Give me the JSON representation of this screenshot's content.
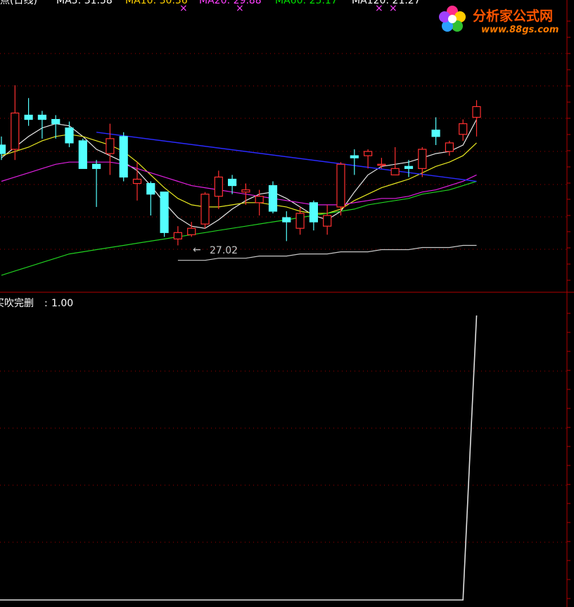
{
  "legend": {
    "title": "要点(日线)",
    "items": [
      {
        "label": "MA5: 31.58",
        "color": "#ffffff"
      },
      {
        "label": "MA10: 30.36",
        "color": "#ffd000"
      },
      {
        "label": "MA20: 29.88",
        "color": "#ff00ff"
      },
      {
        "label": "MA60: 25.17",
        "color": "#00dd00"
      },
      {
        "label": "MA120: 21.27",
        "color": "#ffffff"
      }
    ]
  },
  "logo": {
    "name": "分析家公式网",
    "url": "www.88gs.com"
  },
  "colors": {
    "up": "#ff3030",
    "down": "#54ffff",
    "frame": "#b00000",
    "grid": "#a00000",
    "trendline": "#2222ff"
  },
  "chart_data": [
    {
      "type": "candlestick",
      "title": "要点(日线)",
      "ylim": [
        25,
        37.6
      ],
      "min_marker": "27.02",
      "candles": [
        {
          "o": 31.4,
          "h": 31.8,
          "l": 30.7,
          "c": 31.0
        },
        {
          "o": 31.2,
          "h": 34.2,
          "l": 30.7,
          "c": 32.9
        },
        {
          "o": 32.8,
          "h": 33.6,
          "l": 32.3,
          "c": 32.6
        },
        {
          "o": 32.8,
          "h": 33.0,
          "l": 31.7,
          "c": 32.6
        },
        {
          "o": 32.6,
          "h": 32.8,
          "l": 31.7,
          "c": 32.4
        },
        {
          "o": 32.2,
          "h": 32.5,
          "l": 31.3,
          "c": 31.5
        },
        {
          "o": 31.6,
          "h": 31.7,
          "l": 30.5,
          "c": 30.3
        },
        {
          "o": 30.5,
          "h": 30.7,
          "l": 28.5,
          "c": 30.3
        },
        {
          "o": 31.0,
          "h": 32.4,
          "l": 30.0,
          "c": 31.7
        },
        {
          "o": 31.8,
          "h": 32.0,
          "l": 29.7,
          "c": 29.9
        },
        {
          "o": 29.6,
          "h": 30.6,
          "l": 28.8,
          "c": 29.8
        },
        {
          "o": 29.6,
          "h": 29.7,
          "l": 28.1,
          "c": 29.1
        },
        {
          "o": 29.2,
          "h": 29.2,
          "l": 27.1,
          "c": 27.3
        },
        {
          "o": 27.0,
          "h": 27.6,
          "l": 26.7,
          "c": 27.3
        },
        {
          "o": 27.2,
          "h": 27.8,
          "l": 27.1,
          "c": 27.5
        },
        {
          "o": 27.7,
          "h": 29.2,
          "l": 27.5,
          "c": 29.1
        },
        {
          "o": 29.0,
          "h": 30.2,
          "l": 28.4,
          "c": 29.9
        },
        {
          "o": 29.8,
          "h": 30.0,
          "l": 29.1,
          "c": 29.5
        },
        {
          "o": 29.2,
          "h": 29.6,
          "l": 28.6,
          "c": 29.3
        },
        {
          "o": 28.7,
          "h": 29.3,
          "l": 28.1,
          "c": 29.0
        },
        {
          "o": 29.5,
          "h": 29.7,
          "l": 28.2,
          "c": 28.3
        },
        {
          "o": 28.0,
          "h": 28.3,
          "l": 26.9,
          "c": 27.8
        },
        {
          "o": 27.5,
          "h": 28.5,
          "l": 27.2,
          "c": 28.2
        },
        {
          "o": 28.7,
          "h": 28.8,
          "l": 27.4,
          "c": 27.8
        },
        {
          "o": 27.6,
          "h": 28.6,
          "l": 27.2,
          "c": 28.1
        },
        {
          "o": 28.5,
          "h": 30.6,
          "l": 28.1,
          "c": 30.5
        },
        {
          "o": 30.9,
          "h": 31.2,
          "l": 30.0,
          "c": 30.8
        },
        {
          "o": 30.9,
          "h": 31.2,
          "l": 30.3,
          "c": 31.1
        },
        {
          "o": 30.5,
          "h": 30.8,
          "l": 30.3,
          "c": 30.5
        },
        {
          "o": 30.0,
          "h": 31.3,
          "l": 30.0,
          "c": 30.3
        },
        {
          "o": 30.4,
          "h": 30.7,
          "l": 29.9,
          "c": 30.3
        },
        {
          "o": 30.3,
          "h": 31.3,
          "l": 29.9,
          "c": 31.2
        },
        {
          "o": 32.1,
          "h": 32.7,
          "l": 31.4,
          "c": 31.8
        },
        {
          "o": 31.1,
          "h": 31.6,
          "l": 30.9,
          "c": 31.5
        },
        {
          "o": 31.9,
          "h": 32.6,
          "l": 31.6,
          "c": 32.4
        },
        {
          "o": 32.7,
          "h": 33.5,
          "l": 31.8,
          "c": 33.2
        }
      ],
      "ma_lines": [
        {
          "name": "MA5",
          "color": "#e8e8e8",
          "values": [
            30.8,
            31.3,
            31.8,
            32.2,
            32.4,
            32.3,
            31.8,
            31.2,
            30.9,
            30.6,
            30.2,
            29.5,
            28.7,
            28.0,
            27.6,
            27.5,
            27.9,
            28.4,
            28.8,
            29.1,
            29.2,
            28.9,
            28.5,
            28.1,
            27.9,
            28.3,
            29.2,
            30.0,
            30.4,
            30.5,
            30.6,
            30.8,
            31.0,
            31.1,
            31.4,
            32.6
          ]
        },
        {
          "name": "MA10",
          "color": "#e8e820",
          "values": [
            30.9,
            31.1,
            31.3,
            31.6,
            31.8,
            31.9,
            31.8,
            31.6,
            31.4,
            31.1,
            30.6,
            30.0,
            29.4,
            28.9,
            28.6,
            28.5,
            28.5,
            28.6,
            28.7,
            28.7,
            28.6,
            28.5,
            28.3,
            28.2,
            28.2,
            28.4,
            28.8,
            29.1,
            29.4,
            29.6,
            29.8,
            30.1,
            30.4,
            30.6,
            30.9,
            31.5
          ]
        },
        {
          "name": "MA20",
          "color": "#e020e0",
          "values": [
            29.7,
            29.9,
            30.1,
            30.3,
            30.5,
            30.6,
            30.6,
            30.6,
            30.6,
            30.5,
            30.3,
            30.1,
            29.9,
            29.7,
            29.5,
            29.4,
            29.3,
            29.2,
            29.1,
            29.0,
            28.9,
            28.8,
            28.7,
            28.6,
            28.6,
            28.6,
            28.7,
            28.8,
            28.9,
            28.9,
            29.0,
            29.2,
            29.3,
            29.5,
            29.7,
            30.0
          ]
        },
        {
          "name": "MA60",
          "color": "#20d020",
          "values": [
            25.3,
            25.5,
            25.7,
            25.9,
            26.1,
            26.3,
            26.4,
            26.5,
            26.6,
            26.7,
            26.8,
            26.9,
            27.0,
            27.1,
            27.2,
            27.3,
            27.4,
            27.5,
            27.6,
            27.7,
            27.8,
            27.9,
            28.0,
            28.1,
            28.2,
            28.3,
            28.4,
            28.6,
            28.7,
            28.8,
            28.9,
            29.1,
            29.2,
            29.3,
            29.5,
            29.7
          ]
        },
        {
          "name": "MA120",
          "color": "#c8c8c8",
          "values": [
            null,
            null,
            null,
            null,
            null,
            null,
            null,
            null,
            null,
            null,
            null,
            null,
            null,
            26.0,
            26.0,
            26.0,
            26.1,
            26.1,
            26.1,
            26.2,
            26.2,
            26.2,
            26.3,
            26.3,
            26.3,
            26.4,
            26.4,
            26.4,
            26.5,
            26.5,
            26.5,
            26.6,
            26.6,
            26.6,
            26.7,
            26.7
          ]
        }
      ],
      "trendline": {
        "start_index": 7,
        "start_value": 32.0,
        "end_index": 35,
        "end_value": 29.7
      }
    },
    {
      "type": "line",
      "title": "买吹完删",
      "value_label": "1.00",
      "ylim": [
        0,
        1
      ],
      "series": [
        {
          "color": "#e0e0e0",
          "values": [
            0,
            0,
            0,
            0,
            0,
            0,
            0,
            0,
            0,
            0,
            0,
            0,
            0,
            0,
            0,
            0,
            0,
            0,
            0,
            0,
            0,
            0,
            0,
            0,
            0,
            0,
            0,
            0,
            0,
            0,
            0,
            0,
            0,
            0,
            0,
            1
          ]
        }
      ]
    }
  ]
}
